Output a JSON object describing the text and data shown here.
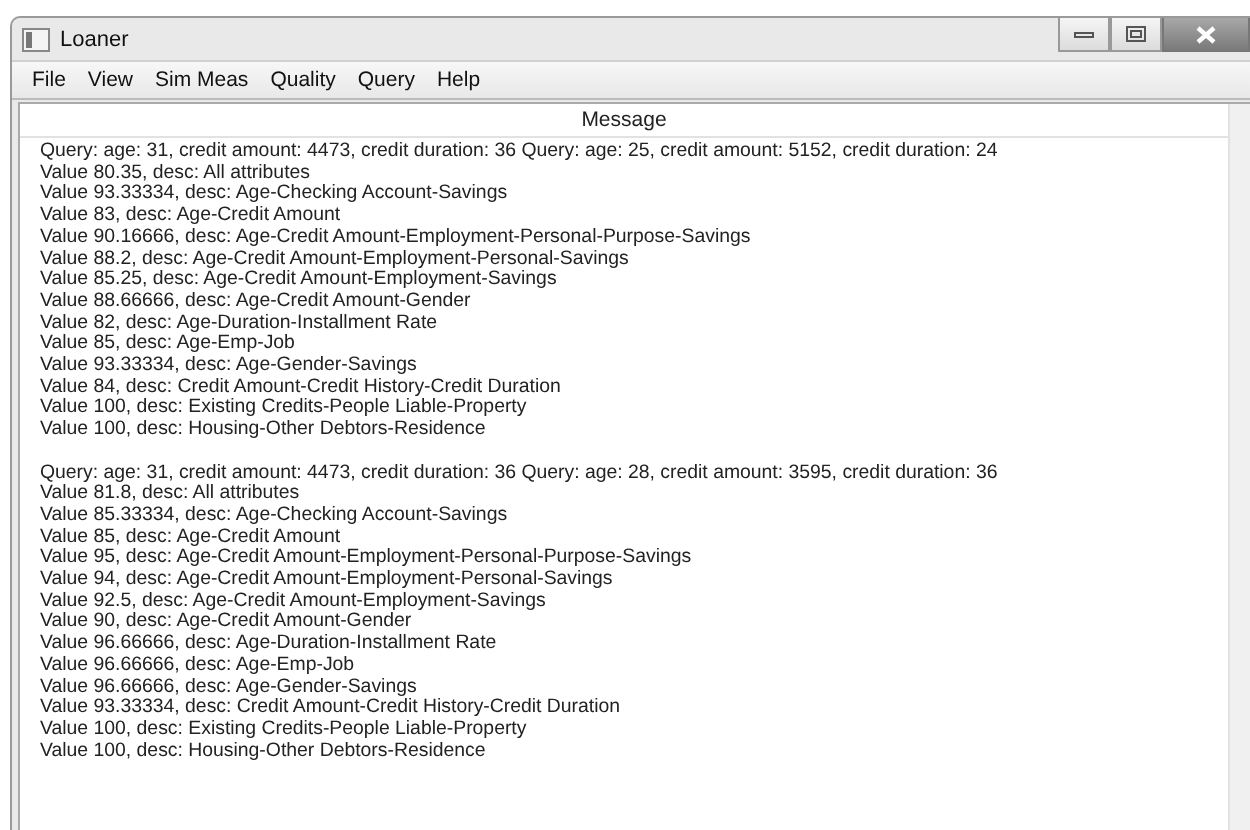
{
  "window": {
    "title": "Loaner"
  },
  "menu": [
    {
      "label": "File"
    },
    {
      "label": "View"
    },
    {
      "label": "Sim Meas"
    },
    {
      "label": "Quality"
    },
    {
      "label": "Query"
    },
    {
      "label": "Help"
    }
  ],
  "message_panel": {
    "header": "Message",
    "blocks": [
      [
        "Query: age: 31, credit amount: 4473, credit duration: 36 Query: age: 25, credit amount: 5152, credit duration: 24",
        "Value 80.35, desc: All attributes",
        "Value 93.33334, desc: Age-Checking Account-Savings",
        "Value 83, desc: Age-Credit Amount",
        "Value 90.16666, desc: Age-Credit Amount-Employment-Personal-Purpose-Savings",
        "Value 88.2, desc: Age-Credit Amount-Employment-Personal-Savings",
        "Value 85.25, desc: Age-Credit Amount-Employment-Savings",
        "Value 88.66666, desc: Age-Credit Amount-Gender",
        "Value 82, desc: Age-Duration-Installment Rate",
        "Value 85, desc: Age-Emp-Job",
        "Value 93.33334, desc: Age-Gender-Savings",
        "Value 84, desc: Credit Amount-Credit History-Credit Duration",
        "Value 100, desc: Existing Credits-People Liable-Property",
        "Value 100, desc: Housing-Other Debtors-Residence"
      ],
      [
        "Query: age: 31, credit amount: 4473, credit duration: 36 Query: age: 28, credit amount: 3595, credit duration: 36",
        "Value 81.8, desc: All attributes",
        "Value 85.33334, desc: Age-Checking Account-Savings",
        "Value 85, desc: Age-Credit Amount",
        "Value 95, desc: Age-Credit Amount-Employment-Personal-Purpose-Savings",
        "Value 94, desc: Age-Credit Amount-Employment-Personal-Savings",
        "Value 92.5, desc: Age-Credit Amount-Employment-Savings",
        "Value 90, desc: Age-Credit Amount-Gender",
        "Value 96.66666, desc: Age-Duration-Installment Rate",
        "Value 96.66666, desc: Age-Emp-Job",
        "Value 96.66666, desc: Age-Gender-Savings",
        "Value 93.33334, desc: Credit Amount-Credit History-Credit Duration",
        "Value 100, desc: Existing Credits-People Liable-Property",
        "Value 100, desc: Housing-Other Debtors-Residence"
      ]
    ]
  }
}
